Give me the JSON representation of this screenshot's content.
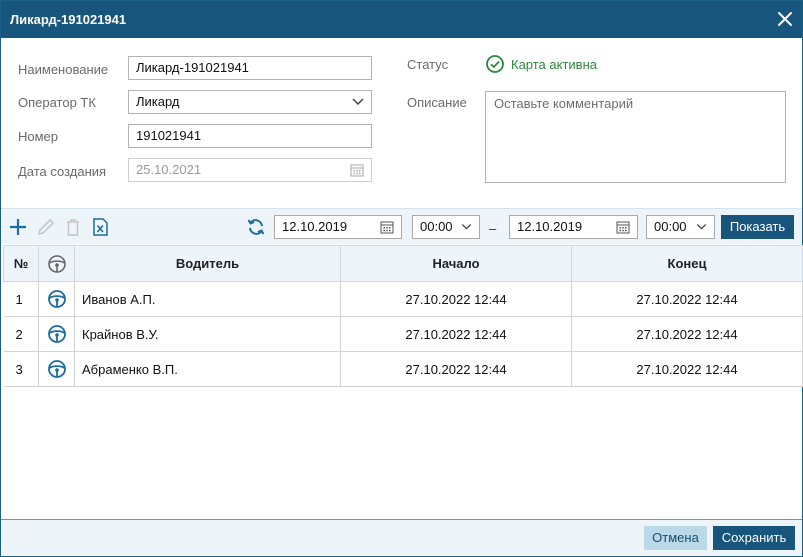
{
  "dialog": {
    "title": "Ликард-191021941"
  },
  "form": {
    "name_label": "Наименование",
    "name_value": "Ликард-191021941",
    "operator_label": "Оператор ТК",
    "operator_value": "Ликард",
    "number_label": "Номер",
    "number_value": "191021941",
    "created_label": "Дата создания",
    "created_value": "25.10.2021",
    "status_label": "Статус",
    "status_value": "Карта активна",
    "description_label": "Описание",
    "description_placeholder": "Оставьте комментарий"
  },
  "toolbar": {
    "date_from": "12.10.2019",
    "time_from": "00:00",
    "dash": "–",
    "date_to": "12.10.2019",
    "time_to": "00:00",
    "show_button": "Показать"
  },
  "table": {
    "headers": {
      "num": "№",
      "driver": "Водитель",
      "start": "Начало",
      "end": "Конец"
    },
    "rows": [
      {
        "num": "1",
        "driver": "Иванов А.П.",
        "start": "27.10.2022 12:44",
        "end": "27.10.2022 12:44"
      },
      {
        "num": "2",
        "driver": "Крайнов В.У.",
        "start": "27.10.2022 12:44",
        "end": "27.10.2022 12:44"
      },
      {
        "num": "3",
        "driver": "Абраменко В.П.",
        "start": "27.10.2022 12:44",
        "end": "27.10.2022 12:44"
      }
    ]
  },
  "footer": {
    "cancel_button": "Отмена",
    "save_button": "Сохранить"
  },
  "colors": {
    "header_bg": "#18557c",
    "toolbar_bg": "#edf4fa",
    "status_green": "#2a8a3a",
    "icon_blue": "#1a6d9e"
  },
  "icons": [
    "close-icon",
    "check-circle-icon",
    "add-icon",
    "edit-icon",
    "delete-icon",
    "excel-icon",
    "refresh-icon",
    "calendar-icon",
    "chevron-down-icon",
    "steering-wheel-icon"
  ]
}
